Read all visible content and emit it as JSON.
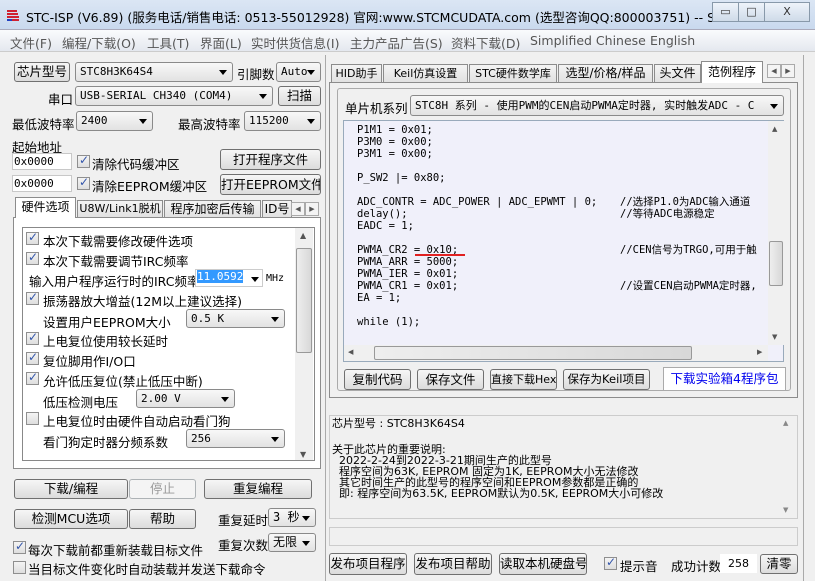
{
  "window": {
    "title": "STC-ISP (V6.89) (服务电话/销售电话: 0513-55012928) 官网:www.STCMCUDATA.com  (选型咨询QQ:800003751) -- STC...",
    "minimize": "▭",
    "maximize": "□",
    "close": "X"
  },
  "menu": [
    "文件(F)",
    "编程/下载(O)",
    "工具(T)",
    "界面(L)",
    "实时供货信息(I)",
    "主力产品广告(S)",
    "资料下载(D)",
    "Simplified Chinese",
    "English"
  ],
  "left": {
    "chip_button": "芯片型号",
    "chip_value": "STC8H3K64S4",
    "pins_label": "引脚数",
    "pins_value": "Auto",
    "port_label": "串口",
    "port_value": "USB-SERIAL CH340 (COM4)",
    "scan_button": "扫描",
    "min_baud_label": "最低波特率",
    "min_baud_value": "2400",
    "max_baud_label": "最高波特率",
    "max_baud_value": "115200",
    "start_addr_label": "起始地址",
    "code_addr": "0x0000",
    "clear_code": "清除代码缓冲区",
    "open_program": "打开程序文件",
    "eeprom_addr": "0x0000",
    "clear_eeprom": "清除EEPROM缓冲区",
    "open_eeprom": "打开EEPROM文件",
    "tabs": [
      "硬件选项",
      "U8W/Link1脱机",
      "程序加密后传输",
      "ID号"
    ],
    "options": {
      "modify_hw": "本次下载需要修改硬件选项",
      "adjust_irc": "本次下载需要调节IRC频率",
      "irc_label": "输入用户程序运行时的IRC频率",
      "irc_value": "11.0592",
      "irc_unit": "MHz",
      "osc_gain": "振荡器放大增益(12M以上建议选择)",
      "eeprom_size_label": "设置用户EEPROM大小",
      "eeprom_size": "0.5 K",
      "long_delay": "上电复位使用较长延时",
      "reset_io": "复位脚用作I/O口",
      "lvr": "允许低压复位(禁止低压中断)",
      "lvd_label": "低压检测电压",
      "lvd_value": "2.00 V",
      "wdt": "上电复位时由硬件自动启动看门狗",
      "wdt_div_label": "看门狗定时器分频系数",
      "wdt_div": "256"
    },
    "download": "下载/编程",
    "stop": "停止",
    "repeat": "重复编程",
    "detect": "检测MCU选项",
    "help": "帮助",
    "repeat_delay_label": "重复延时",
    "repeat_delay": "3 秒",
    "repeat_count_label": "重复次数",
    "repeat_count": "无限",
    "reload": "每次下载前都重新装载目标文件",
    "auto_send": "当目标文件变化时自动装载并发送下载命令"
  },
  "right": {
    "tabs": [
      "HID助手",
      "Keil仿真设置",
      "STC硬件数学库",
      "选型/价格/样品",
      "头文件",
      "范例程序"
    ],
    "series_label": "单片机系列",
    "series_value": "STC8H 系列 - 使用PWM的CEN启动PWMA定时器, 实时触发ADC - C",
    "code": [
      {
        "c": "P1M1 = 0x01;",
        "m": ""
      },
      {
        "c": "P3M0 = 0x00;",
        "m": ""
      },
      {
        "c": "P3M1 = 0x00;",
        "m": ""
      },
      {
        "c": "",
        "m": ""
      },
      {
        "c": "P_SW2 |= 0x80;",
        "m": ""
      },
      {
        "c": "",
        "m": ""
      },
      {
        "c": "ADC_CONTR = ADC_POWER | ADC_EPWMT | 0;",
        "m": "//选择P1.0为ADC输入通道"
      },
      {
        "c": "delay();",
        "m": "//等待ADC电源稳定"
      },
      {
        "c": "EADC = 1;",
        "m": ""
      },
      {
        "c": "",
        "m": ""
      },
      {
        "c": "PWMA_CR2 = 0x10;",
        "m": "//CEN信号为TRGO,可用于触"
      },
      {
        "c": "PWMA_ARR = 5000;",
        "m": ""
      },
      {
        "c": "PWMA_IER = 0x01;",
        "m": ""
      },
      {
        "c": "PWMA_CR1 = 0x01;",
        "m": "//设置CEN启动PWMA定时器,"
      },
      {
        "c": "EA = 1;",
        "m": ""
      },
      {
        "c": "",
        "m": ""
      },
      {
        "c": "while (1);",
        "m": ""
      }
    ],
    "copy_code": "复制代码",
    "save_file": "保存文件",
    "direct_download": "直接下载Hex",
    "save_keil": "保存为Keil项目",
    "download_kit": "下载实验箱4程序包",
    "info": [
      "芯片型号 : STC8H3K64S4",
      "",
      "关于此芯片的重要说明:",
      "  2022-2-24到2022-3-21期间生产的此型号",
      "  程序空间为63K, EEPROM 固定为1K, EEPROM大小无法修改",
      "  其它时间生产的此型号的程序空间和EEPROM参数都是正确的",
      "  即: 程序空间为63.5K, EEPROM默认为0.5K, EEPROM大小可修改"
    ],
    "publish_program": "发布项目程序",
    "publish_help": "发布项目帮助",
    "read_disk": "读取本机硬盘号",
    "beep": "提示音",
    "success_label": "成功计数",
    "success_count": "258",
    "clear": "清零"
  },
  "colors": {
    "link": "#0000ee",
    "code_bg": "#f0f0fa",
    "highlight": "#3399ff",
    "underline": "#e02020"
  }
}
